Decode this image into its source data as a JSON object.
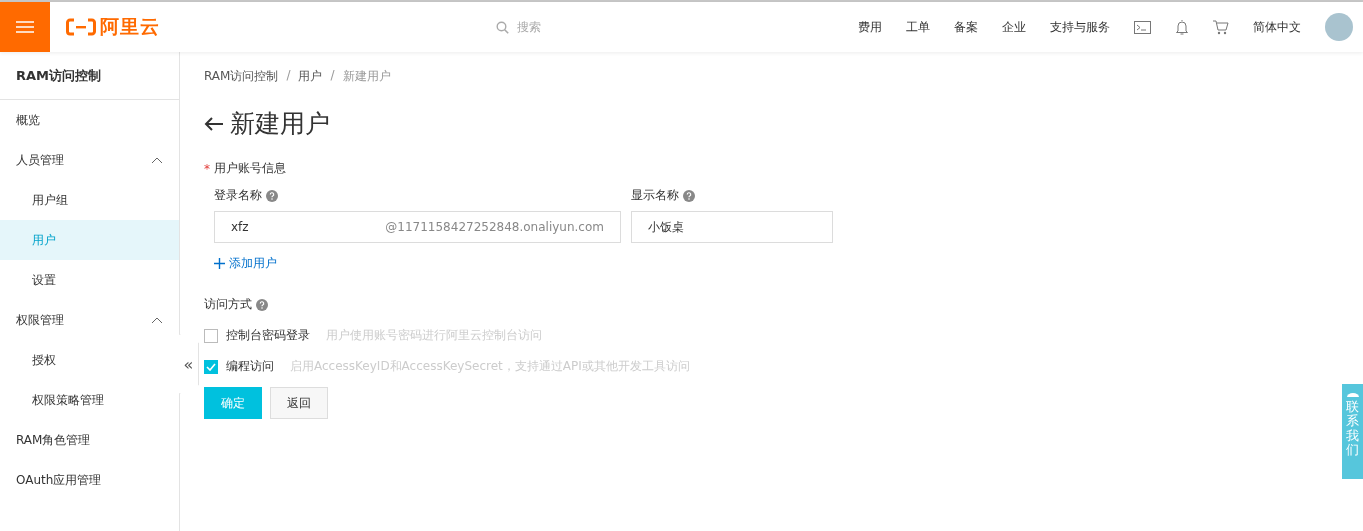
{
  "header": {
    "logo_text": "阿里云",
    "search": {
      "placeholder": "搜索"
    },
    "nav": [
      "费用",
      "工单",
      "备案",
      "企业",
      "支持与服务"
    ],
    "language": "简体中文"
  },
  "sidebar": {
    "title": "RAM访问控制",
    "items": [
      {
        "label": "概览",
        "selected": false
      },
      {
        "label": "人员管理",
        "expanded": true,
        "selected": false,
        "children": [
          {
            "label": "用户组",
            "selected": false
          },
          {
            "label": "用户",
            "selected": true
          },
          {
            "label": "设置",
            "selected": false
          }
        ]
      },
      {
        "label": "权限管理",
        "expanded": true,
        "selected": false,
        "children": [
          {
            "label": "授权",
            "selected": false
          },
          {
            "label": "权限策略管理",
            "selected": false
          }
        ]
      },
      {
        "label": "RAM角色管理",
        "selected": false
      },
      {
        "label": "OAuth应用管理",
        "selected": false
      }
    ],
    "collapse": "«"
  },
  "breadcrumb": {
    "items": [
      "RAM访问控制",
      "用户",
      "新建用户"
    ],
    "separators": [
      "/",
      "/"
    ]
  },
  "page_title": "新建用户",
  "form": {
    "section_label": "用户账号信息",
    "required_mark": "*",
    "login_name": {
      "label": "登录名称",
      "value": "xfz",
      "suffix": "@1171158427252848.onaliyun.com"
    },
    "display_name": {
      "label": "显示名称",
      "value": "小饭桌"
    },
    "add_user": "添加用户",
    "access_label": "访问方式",
    "access_options": [
      {
        "label": "控制台密码登录",
        "hint": "用户使用账号密码进行阿里云控制台访问",
        "checked": false
      },
      {
        "label": "编程访问",
        "hint": "启用AccessKeyID和AccessKeySecret，支持通过API或其他开发工具访问",
        "checked": true
      }
    ],
    "buttons": [
      {
        "label": "确定",
        "kind": "primary"
      },
      {
        "label": "返回",
        "kind": "secondary"
      }
    ]
  },
  "contact": "联系我们"
}
